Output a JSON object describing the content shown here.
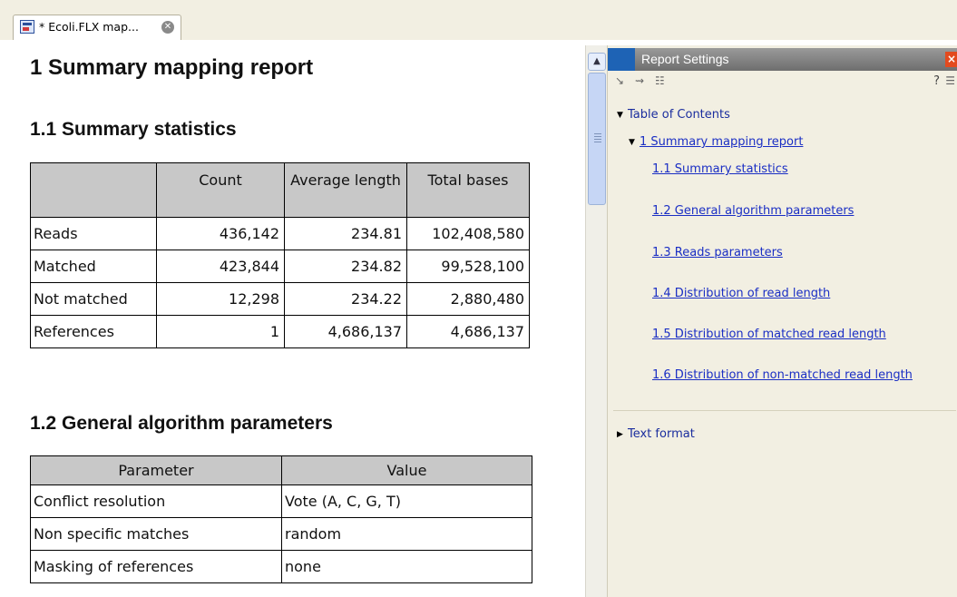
{
  "tab": {
    "label": "* Ecoli.FLX map...",
    "icon": "report-document-icon",
    "close_icon": "close-icon"
  },
  "report": {
    "title": "1 Summary mapping report",
    "summary": {
      "heading": "1.1 Summary statistics",
      "columns": [
        "",
        "Count",
        "Average length",
        "Total bases"
      ],
      "rows": [
        [
          "Reads",
          "436,142",
          "234.81",
          "102,408,580"
        ],
        [
          "Matched",
          "423,844",
          "234.82",
          "99,528,100"
        ],
        [
          "Not matched",
          "12,298",
          "234.22",
          "2,880,480"
        ],
        [
          "References",
          "1",
          "4,686,137",
          "4,686,137"
        ]
      ]
    },
    "params": {
      "heading": "1.2 General algorithm parameters",
      "columns": [
        "Parameter",
        "Value"
      ],
      "rows": [
        [
          "Conflict resolution",
          "Vote (A, C, G, T)"
        ],
        [
          "Non specific matches",
          "random"
        ],
        [
          "Masking of references",
          "none"
        ]
      ]
    }
  },
  "panel": {
    "title": "Report Settings",
    "help": "?",
    "toolbar_icons": [
      "expand-all-icon",
      "collapse-all-icon",
      "tree-view-icon",
      "view-menu-icon"
    ],
    "toc": {
      "label": "Table of Contents",
      "section": "1 Summary mapping report",
      "items": [
        "1.1 Summary statistics",
        "1.2 General algorithm parameters",
        "1.3 Reads parameters",
        "1.4 Distribution of read length",
        "1.5 Distribution of matched read length",
        "1.6 Distribution of non-matched read length"
      ]
    },
    "text_format": "Text format"
  },
  "colors": {
    "tab_strip_bg": "#f2efe2",
    "panel_bg": "#f2efe2",
    "table_header_bg": "#c8c8c8",
    "link": "#1a2ec4",
    "panel_accent": "#1e63b5",
    "panel_close": "#e34a1e"
  }
}
